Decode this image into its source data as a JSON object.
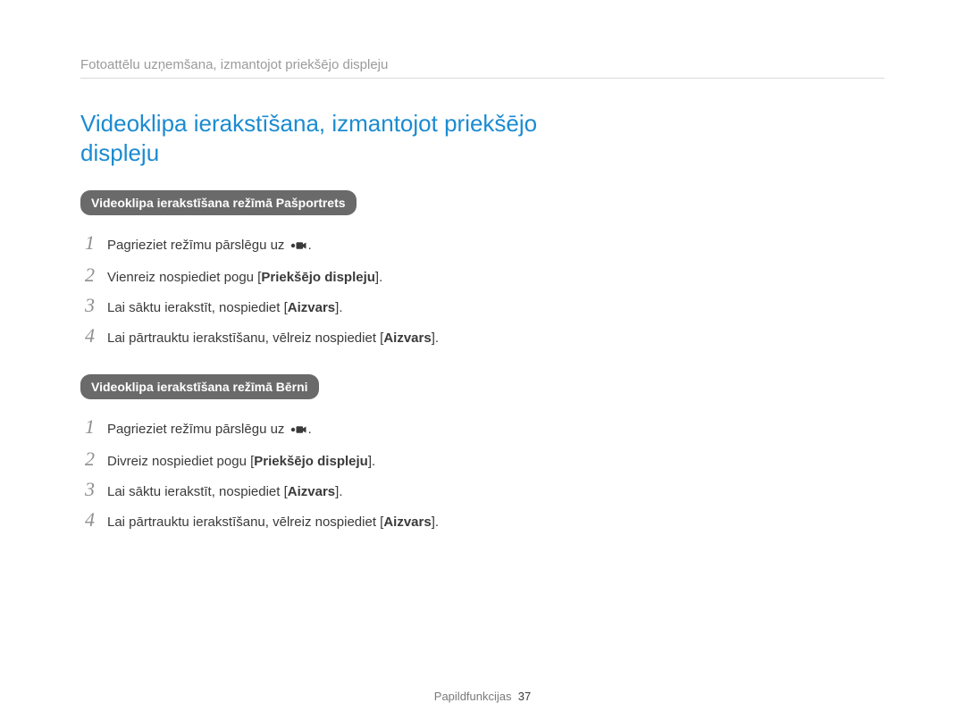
{
  "breadcrumb": "Fotoattēlu uzņemšana, izmantojot priekšējo displeju",
  "title": "Videoklipa ierakstīšana, izmantojot priekšējo displeju",
  "sections": [
    {
      "badge": "Videoklipa ierakstīšana režīmā Pašportrets",
      "steps": [
        {
          "num": "1",
          "pre": "Pagrieziet režīmu pārslēgu uz ",
          "icon": true,
          "post": "."
        },
        {
          "num": "2",
          "pre": "Vienreiz nospiediet pogu [",
          "bold": "Priekšējo displeju",
          "post": "]."
        },
        {
          "num": "3",
          "pre": "Lai sāktu ierakstīt, nospiediet [",
          "bold": "Aizvars",
          "post": "]."
        },
        {
          "num": "4",
          "pre": "Lai pārtrauktu ierakstīšanu, vēlreiz nospiediet [",
          "bold": "Aizvars",
          "post": "]."
        }
      ]
    },
    {
      "badge": "Videoklipa ierakstīšana režīmā Bērni",
      "steps": [
        {
          "num": "1",
          "pre": "Pagrieziet režīmu pārslēgu uz ",
          "icon": true,
          "post": "."
        },
        {
          "num": "2",
          "pre": "Divreiz nospiediet pogu [",
          "bold": "Priekšējo displeju",
          "post": "]."
        },
        {
          "num": "3",
          "pre": "Lai sāktu ierakstīt, nospiediet [",
          "bold": "Aizvars",
          "post": "]."
        },
        {
          "num": "4",
          "pre": "Lai pārtrauktu ierakstīšanu, vēlreiz nospiediet [",
          "bold": "Aizvars",
          "post": "]."
        }
      ]
    }
  ],
  "footer": {
    "label": "Papildfunkcijas",
    "page": "37"
  },
  "icons": {
    "video": "video-mode-icon"
  }
}
